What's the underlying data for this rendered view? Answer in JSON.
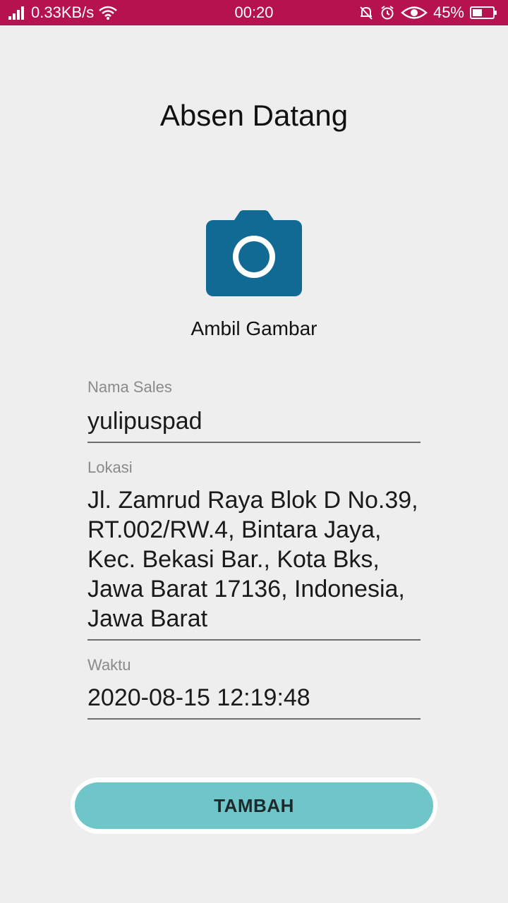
{
  "status_bar": {
    "network_speed": "0.33KB/s",
    "time": "00:20",
    "battery": "45%",
    "icons": [
      "signal-icon",
      "wifi-icon",
      "notifications-off-icon",
      "alarm-icon",
      "eye-icon",
      "battery-icon"
    ],
    "background": "#b5124f"
  },
  "page": {
    "title": "Absen Datang"
  },
  "camera": {
    "icon": "camera-icon",
    "color": "#116a94",
    "label": "Ambil Gambar"
  },
  "form": {
    "nama_sales": {
      "label": "Nama Sales",
      "value": "yulipuspad"
    },
    "lokasi": {
      "label": "Lokasi",
      "value": "Jl. Zamrud Raya Blok D No.39, RT.002/RW.4, Bintara Jaya, Kec. Bekasi Bar., Kota Bks, Jawa Barat 17136, Indonesia, Jawa Barat"
    },
    "waktu": {
      "label": "Waktu",
      "value": "2020-08-15 12:19:48"
    }
  },
  "submit": {
    "label": "TAMBAH",
    "color": "#6fc6c8"
  }
}
